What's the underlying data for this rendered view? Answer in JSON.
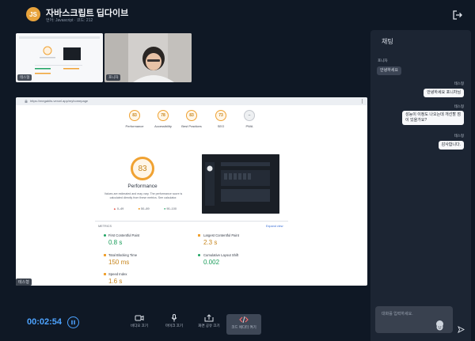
{
  "header": {
    "avatar_initials": "JS",
    "title": "자바스크립트 딥다이브",
    "meta": "언어: Javascript · 코드: 212"
  },
  "videos": [
    {
      "label": "테스형"
    },
    {
      "label": "포니차"
    }
  ],
  "shared_screen": {
    "url": "https://megabits.vercel.app/myhomepage",
    "categories": [
      {
        "score": "83",
        "label": "Performance"
      },
      {
        "score": "78",
        "label": "Accessibility"
      },
      {
        "score": "83",
        "label": "Best Practices"
      },
      {
        "score": "73",
        "label": "SEO"
      },
      {
        "score": "",
        "label": "PWA"
      }
    ],
    "main_score": "83",
    "main_label": "Performance",
    "description": "Values are estimated and may vary. The performance score is calculated directly from these metrics. See calculator.",
    "legend": [
      "0–49",
      "50–89",
      "90–100"
    ],
    "metrics_header": "METRICS",
    "expand_label": "Expand view",
    "metrics": [
      {
        "name": "First Contentful Paint",
        "value": "0.8 s",
        "status": "good"
      },
      {
        "name": "Largest Contentful Paint",
        "value": "2.3 s",
        "status": "average"
      },
      {
        "name": "Total Blocking Time",
        "value": "150 ms",
        "status": "average"
      },
      {
        "name": "Cumulative Layout Shift",
        "value": "0.002",
        "status": "good"
      },
      {
        "name": "Speed Index",
        "value": "1.6 s",
        "status": "average"
      }
    ],
    "presenter_label": "테스형"
  },
  "chat": {
    "title": "채팅",
    "messages": [
      {
        "sender": "포니차",
        "text": "안녕하세요",
        "direction": "in"
      },
      {
        "sender": "테스형",
        "text": "안녕하세요 포니차님",
        "direction": "out"
      },
      {
        "sender": "테스형",
        "text": "성능이 이정도 나오는데 개선할 점이 있을가요?",
        "direction": "out"
      },
      {
        "sender": "테스형",
        "text": "감사합니다.",
        "direction": "out"
      }
    ],
    "input_placeholder": "대화를 입력하세요."
  },
  "controls": {
    "timer": "00:02:54",
    "buttons": [
      {
        "label": "비디오 끄기",
        "icon": "video-icon"
      },
      {
        "label": "마이크 끄기",
        "icon": "mic-icon"
      },
      {
        "label": "화면 공유 끄기",
        "icon": "share-screen-icon"
      },
      {
        "label": "코드 에디터 켜기",
        "icon": "code-icon"
      }
    ]
  },
  "colors": {
    "background": "#0f1825",
    "accent": "#4da3ff",
    "score_orange": "#f0a232",
    "good_green": "#1fa463"
  }
}
